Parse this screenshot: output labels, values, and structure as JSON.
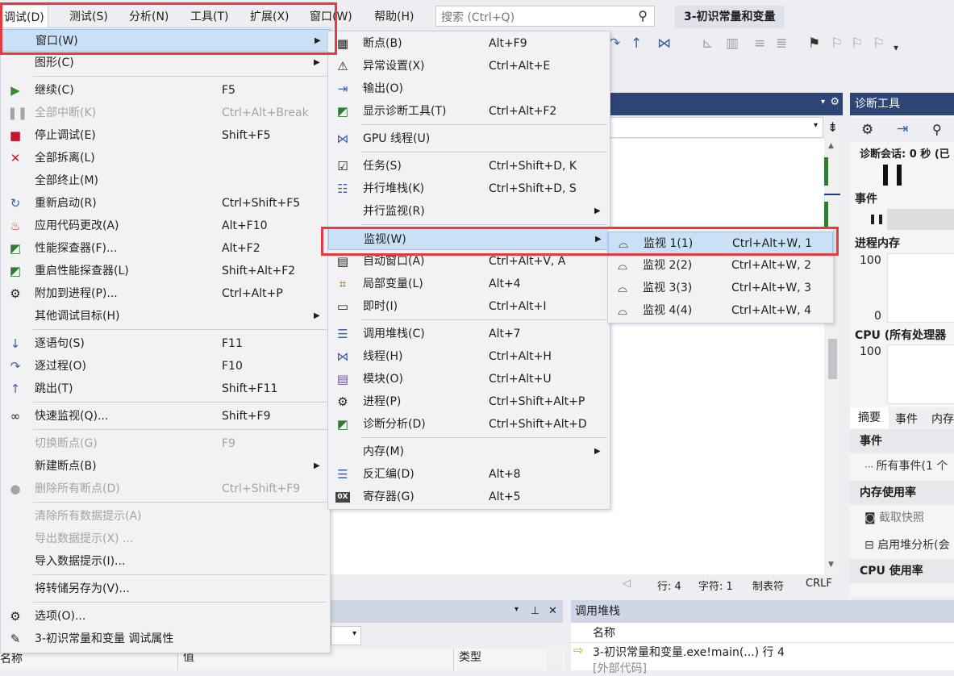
{
  "menubar": {
    "items": [
      "调试(D)",
      "测试(S)",
      "分析(N)",
      "工具(T)",
      "扩展(X)",
      "窗口(W)",
      "帮助(H)"
    ],
    "search_placeholder": "搜索 (Ctrl+Q)",
    "solution_title": "3-初识常量和变量"
  },
  "debug_menu": {
    "items": [
      {
        "label": "窗口(W)",
        "shortcut": "",
        "submenu": true,
        "state": "highlighted"
      },
      {
        "label": "图形(C)",
        "shortcut": "",
        "submenu": true
      },
      {
        "label": "继续(C)",
        "shortcut": "F5",
        "icon": "play-icon"
      },
      {
        "label": "全部中断(K)",
        "shortcut": "Ctrl+Alt+Break",
        "icon": "pause-icon",
        "disabled": true
      },
      {
        "label": "停止调试(E)",
        "shortcut": "Shift+F5",
        "icon": "stop-icon"
      },
      {
        "label": "全部拆离(L)",
        "shortcut": "",
        "icon": "detach-icon"
      },
      {
        "label": "全部终止(M)",
        "shortcut": ""
      },
      {
        "label": "重新启动(R)",
        "shortcut": "Ctrl+Shift+F5",
        "icon": "restart-icon"
      },
      {
        "label": "应用代码更改(A)",
        "shortcut": "Alt+F10",
        "icon": "hot-reload-icon"
      },
      {
        "label": "性能探查器(F)...",
        "shortcut": "Alt+F2",
        "icon": "profiler-icon"
      },
      {
        "label": "重启性能探查器(L)",
        "shortcut": "Shift+Alt+F2",
        "icon": "profiler-restart-icon"
      },
      {
        "label": "附加到进程(P)...",
        "shortcut": "Ctrl+Alt+P",
        "icon": "attach-process-icon"
      },
      {
        "label": "其他调试目标(H)",
        "shortcut": "",
        "submenu": true
      },
      {
        "label": "逐语句(S)",
        "shortcut": "F11",
        "icon": "step-into-icon"
      },
      {
        "label": "逐过程(O)",
        "shortcut": "F10",
        "icon": "step-over-icon"
      },
      {
        "label": "跳出(T)",
        "shortcut": "Shift+F11",
        "icon": "step-out-icon"
      },
      {
        "label": "快速监视(Q)...",
        "shortcut": "Shift+F9",
        "icon": "quickwatch-icon"
      },
      {
        "label": "切换断点(G)",
        "shortcut": "F9",
        "disabled": true
      },
      {
        "label": "新建断点(B)",
        "shortcut": "",
        "submenu": true
      },
      {
        "label": "删除所有断点(D)",
        "shortcut": "Ctrl+Shift+F9",
        "icon": "delete-breakpoints-icon",
        "disabled": true
      },
      {
        "label": "清除所有数据提示(A)",
        "shortcut": "",
        "disabled": true
      },
      {
        "label": "导出数据提示(X) ...",
        "shortcut": "",
        "disabled": true
      },
      {
        "label": "导入数据提示(I)...",
        "shortcut": ""
      },
      {
        "label": "将转储另存为(V)...",
        "shortcut": ""
      },
      {
        "label": "选项(O)...",
        "shortcut": "",
        "icon": "gear-icon"
      },
      {
        "label": "3-初识常量和变量 调试属性",
        "shortcut": "",
        "icon": "wrench-icon"
      }
    ]
  },
  "window_menu": {
    "items": [
      {
        "label": "断点(B)",
        "shortcut": "Alt+F9",
        "icon": "breakpoints-window-icon"
      },
      {
        "label": "异常设置(X)",
        "shortcut": "Ctrl+Alt+E",
        "icon": "exception-settings-icon"
      },
      {
        "label": "输出(O)",
        "shortcut": "",
        "icon": "output-icon"
      },
      {
        "label": "显示诊断工具(T)",
        "shortcut": "Ctrl+Alt+F2",
        "icon": "diagnostic-tools-icon"
      },
      {
        "label": "GPU 线程(U)",
        "shortcut": "",
        "icon": "gpu-threads-icon"
      },
      {
        "label": "任务(S)",
        "shortcut": "Ctrl+Shift+D, K",
        "icon": "tasks-icon"
      },
      {
        "label": "并行堆栈(K)",
        "shortcut": "Ctrl+Shift+D, S",
        "icon": "parallel-stacks-icon"
      },
      {
        "label": "并行监视(R)",
        "shortcut": "",
        "submenu": true
      },
      {
        "label": "监视(W)",
        "shortcut": "",
        "submenu": true,
        "state": "highlighted"
      },
      {
        "label": "自动窗口(A)",
        "shortcut": "Ctrl+Alt+V, A",
        "icon": "autos-icon"
      },
      {
        "label": "局部变量(L)",
        "shortcut": "Alt+4",
        "icon": "locals-icon"
      },
      {
        "label": "即时(I)",
        "shortcut": "Ctrl+Alt+I",
        "icon": "immediate-icon"
      },
      {
        "label": "调用堆栈(C)",
        "shortcut": "Alt+7",
        "icon": "call-stack-icon"
      },
      {
        "label": "线程(H)",
        "shortcut": "Ctrl+Alt+H",
        "icon": "threads-icon"
      },
      {
        "label": "模块(O)",
        "shortcut": "Ctrl+Alt+U",
        "icon": "modules-icon"
      },
      {
        "label": "进程(P)",
        "shortcut": "Ctrl+Shift+Alt+P",
        "icon": "processes-icon"
      },
      {
        "label": "诊断分析(D)",
        "shortcut": "Ctrl+Shift+Alt+D",
        "icon": "diagnostic-analysis-icon"
      },
      {
        "label": "内存(M)",
        "shortcut": "",
        "submenu": true
      },
      {
        "label": "反汇编(D)",
        "shortcut": "Alt+8",
        "icon": "disassembly-icon"
      },
      {
        "label": "寄存器(G)",
        "shortcut": "Alt+5",
        "icon": "registers-icon"
      }
    ]
  },
  "watch_menu": {
    "items": [
      {
        "label": "监视 1(1)",
        "shortcut": "Ctrl+Alt+W, 1",
        "state": "highlighted"
      },
      {
        "label": "监视 2(2)",
        "shortcut": "Ctrl+Alt+W, 2"
      },
      {
        "label": "监视 3(3)",
        "shortcut": "Ctrl+Alt+W, 3"
      },
      {
        "label": "监视 4(4)",
        "shortcut": "Ctrl+Alt+W, 4"
      }
    ]
  },
  "status_bar": {
    "line": "行: 4",
    "char": "字符: 1",
    "tabs": "制表符",
    "eol": "CRLF"
  },
  "diagnostics": {
    "title": "诊断工具",
    "session": "诊断会话: 0 秒 (已",
    "events_label": "事件",
    "memory_label": "进程内存",
    "memory_max": "100",
    "memory_min": "0",
    "cpu_label": "CPU (所有处理器",
    "cpu_max": "100",
    "tabs": [
      "摘要",
      "事件",
      "内存"
    ],
    "section_events": "事件",
    "all_events": "所有事件(1 个",
    "section_memory": "内存使用率",
    "take_snapshot": "截取快照",
    "heap_profiling": "启用堆分析(会",
    "section_cpu": "CPU 使用率"
  },
  "locals_panel": {
    "columns": [
      "名称",
      "值",
      "类型"
    ]
  },
  "callstack_panel": {
    "title": "调用堆栈",
    "column": "名称",
    "rows": [
      "3-初识常量和变量.exe!main(...) 行 4",
      "[外部代码]"
    ]
  },
  "colors": {
    "accent_red": "#e8393f",
    "highlight": "#c9e0f7",
    "panel_header": "#2d4474"
  }
}
